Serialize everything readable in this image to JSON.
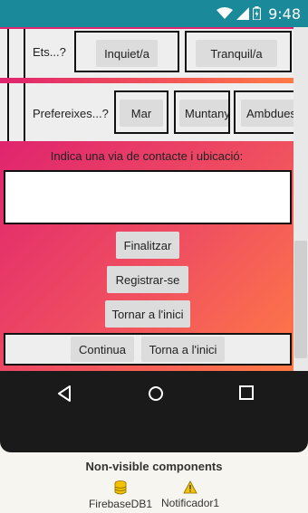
{
  "status_bar": {
    "time": "9:48"
  },
  "row_ets": {
    "label": "Ets...?",
    "options": [
      "Inquiet/a",
      "Tranquil/a"
    ]
  },
  "row_prefereixes": {
    "label": "Prefereixes...?",
    "options": [
      "Mar",
      "Muntanya",
      "Ambdues"
    ]
  },
  "contact": {
    "prompt": "Indica una via de contacte i ubicació:",
    "value": ""
  },
  "actions": {
    "finalitzar": "Finalitzar",
    "registrar": "Registrar-se",
    "tornar": "Tornar a l'inici"
  },
  "footer_buttons": {
    "continua": "Continua",
    "torna": "Torna a l'inici"
  },
  "non_visible": {
    "title": "Non-visible components",
    "items": [
      {
        "name": "FirebaseDB1",
        "icon": "database-icon"
      },
      {
        "name": "Notificador1",
        "icon": "warning-icon"
      }
    ]
  },
  "colors": {
    "status_bar": "#1a8a9a",
    "gradient_start": "#e0246e",
    "gradient_end": "#ff7a45",
    "background": "#f6f5ef"
  }
}
